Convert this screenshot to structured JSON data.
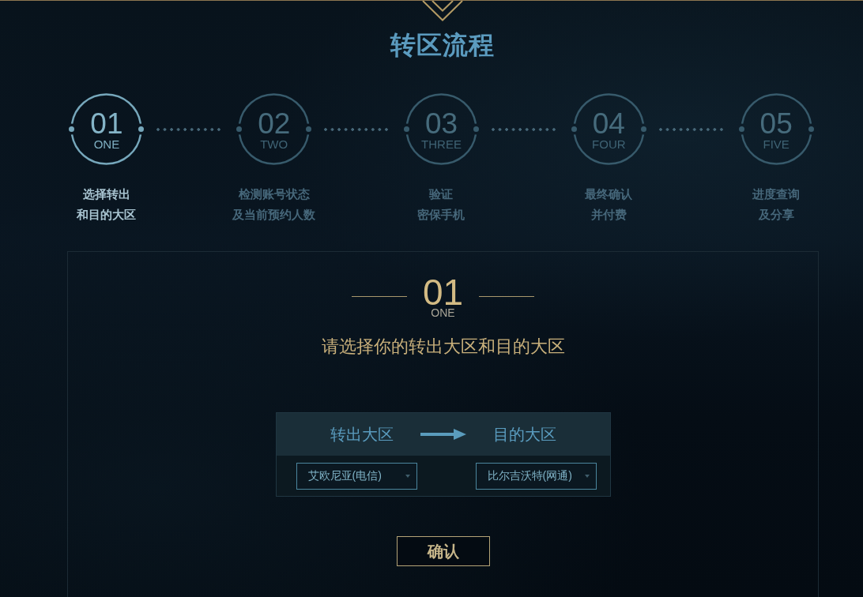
{
  "header": {
    "title": "转区流程"
  },
  "steps": [
    {
      "number": "01",
      "word": "ONE",
      "label_lines": [
        "选择转出",
        "和目的大区"
      ],
      "selected": true
    },
    {
      "number": "02",
      "word": "TWO",
      "label_lines": [
        "检测账号状态",
        "及当前预约人数"
      ],
      "selected": false
    },
    {
      "number": "03",
      "word": "THREE",
      "label_lines": [
        "验证",
        "密保手机"
      ],
      "selected": false
    },
    {
      "number": "04",
      "word": "FOUR",
      "label_lines": [
        "最终确认",
        "并付费"
      ],
      "selected": false
    },
    {
      "number": "05",
      "word": "FIVE",
      "label_lines": [
        "进度查询",
        "及分享"
      ],
      "selected": false
    }
  ],
  "panel": {
    "step_number": "01",
    "step_word": "ONE",
    "instruction": "请选择你的转出大区和目的大区",
    "transfer": {
      "from_label": "转出大区",
      "to_label": "目的大区",
      "from_value": "艾欧尼亚(电信)",
      "to_value": "比尔吉沃特(网通)"
    },
    "confirm_button": "确认"
  }
}
